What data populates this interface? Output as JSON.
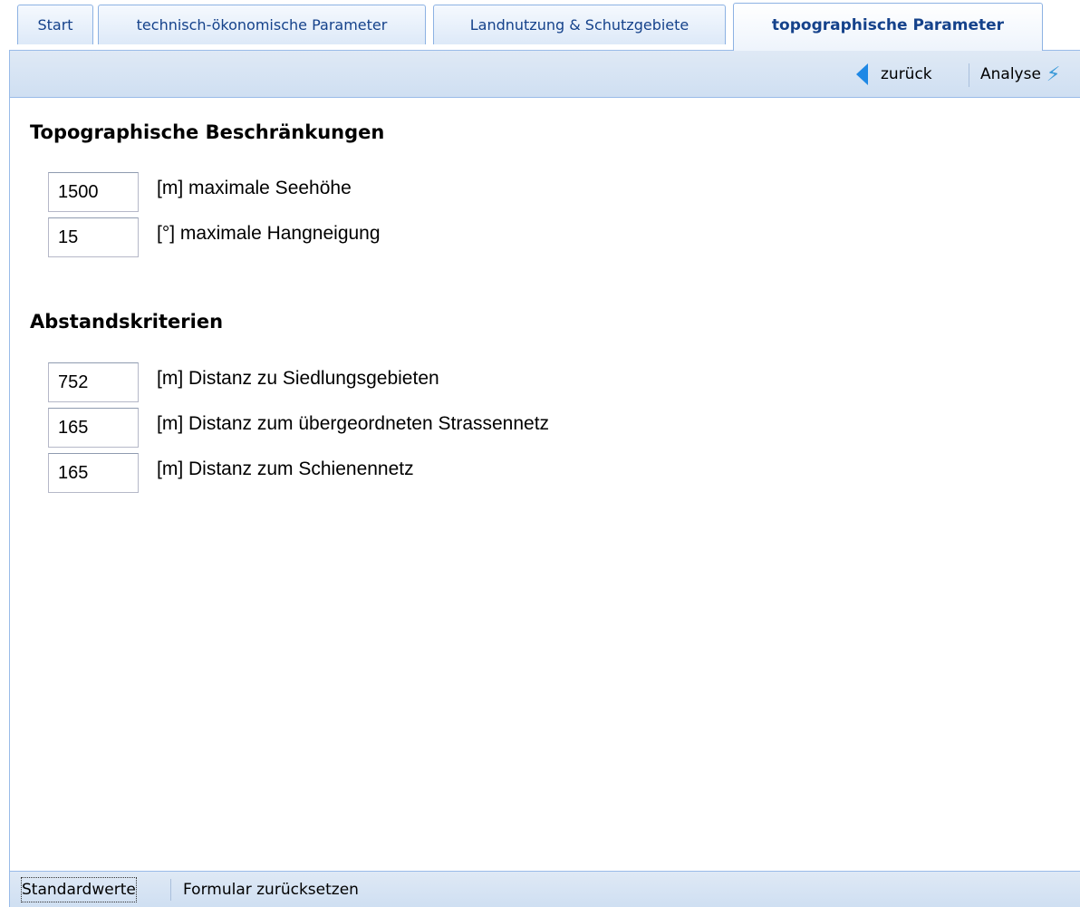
{
  "tabs": [
    {
      "label": "Start"
    },
    {
      "label": "technisch-ökonomische Parameter"
    },
    {
      "label": "Landnutzung & Schutzgebiete"
    },
    {
      "label": "topographische Parameter",
      "active": true
    }
  ],
  "toolbar": {
    "back_label": "zurück",
    "back_icon": "arrow-left-icon",
    "analyse_label": "Analyse",
    "analyse_icon": "wand-icon"
  },
  "sections": {
    "topo": {
      "title": "Topographische Beschränkungen",
      "fields": [
        {
          "value": "1500",
          "label": "[m] maximale Seehöhe"
        },
        {
          "value": "15",
          "label": "[°] maximale Hangneigung"
        }
      ]
    },
    "distance": {
      "title": "Abstandskriterien",
      "fields": [
        {
          "value": "752",
          "label": "[m] Distanz zu Siedlungsgebieten"
        },
        {
          "value": "165",
          "label": "[m] Distanz zum übergeordneten Strassennetz"
        },
        {
          "value": "165",
          "label": "[m] Distanz zum Schienennetz"
        }
      ]
    }
  },
  "bottombar": {
    "defaults_label": "Standardwerte",
    "reset_label": "Formular zurücksetzen"
  },
  "colors": {
    "accent": "#15428b",
    "border": "#99bbe8",
    "toolbar_bg": "#dfe9f5",
    "back_arrow": "#1e88e5"
  }
}
